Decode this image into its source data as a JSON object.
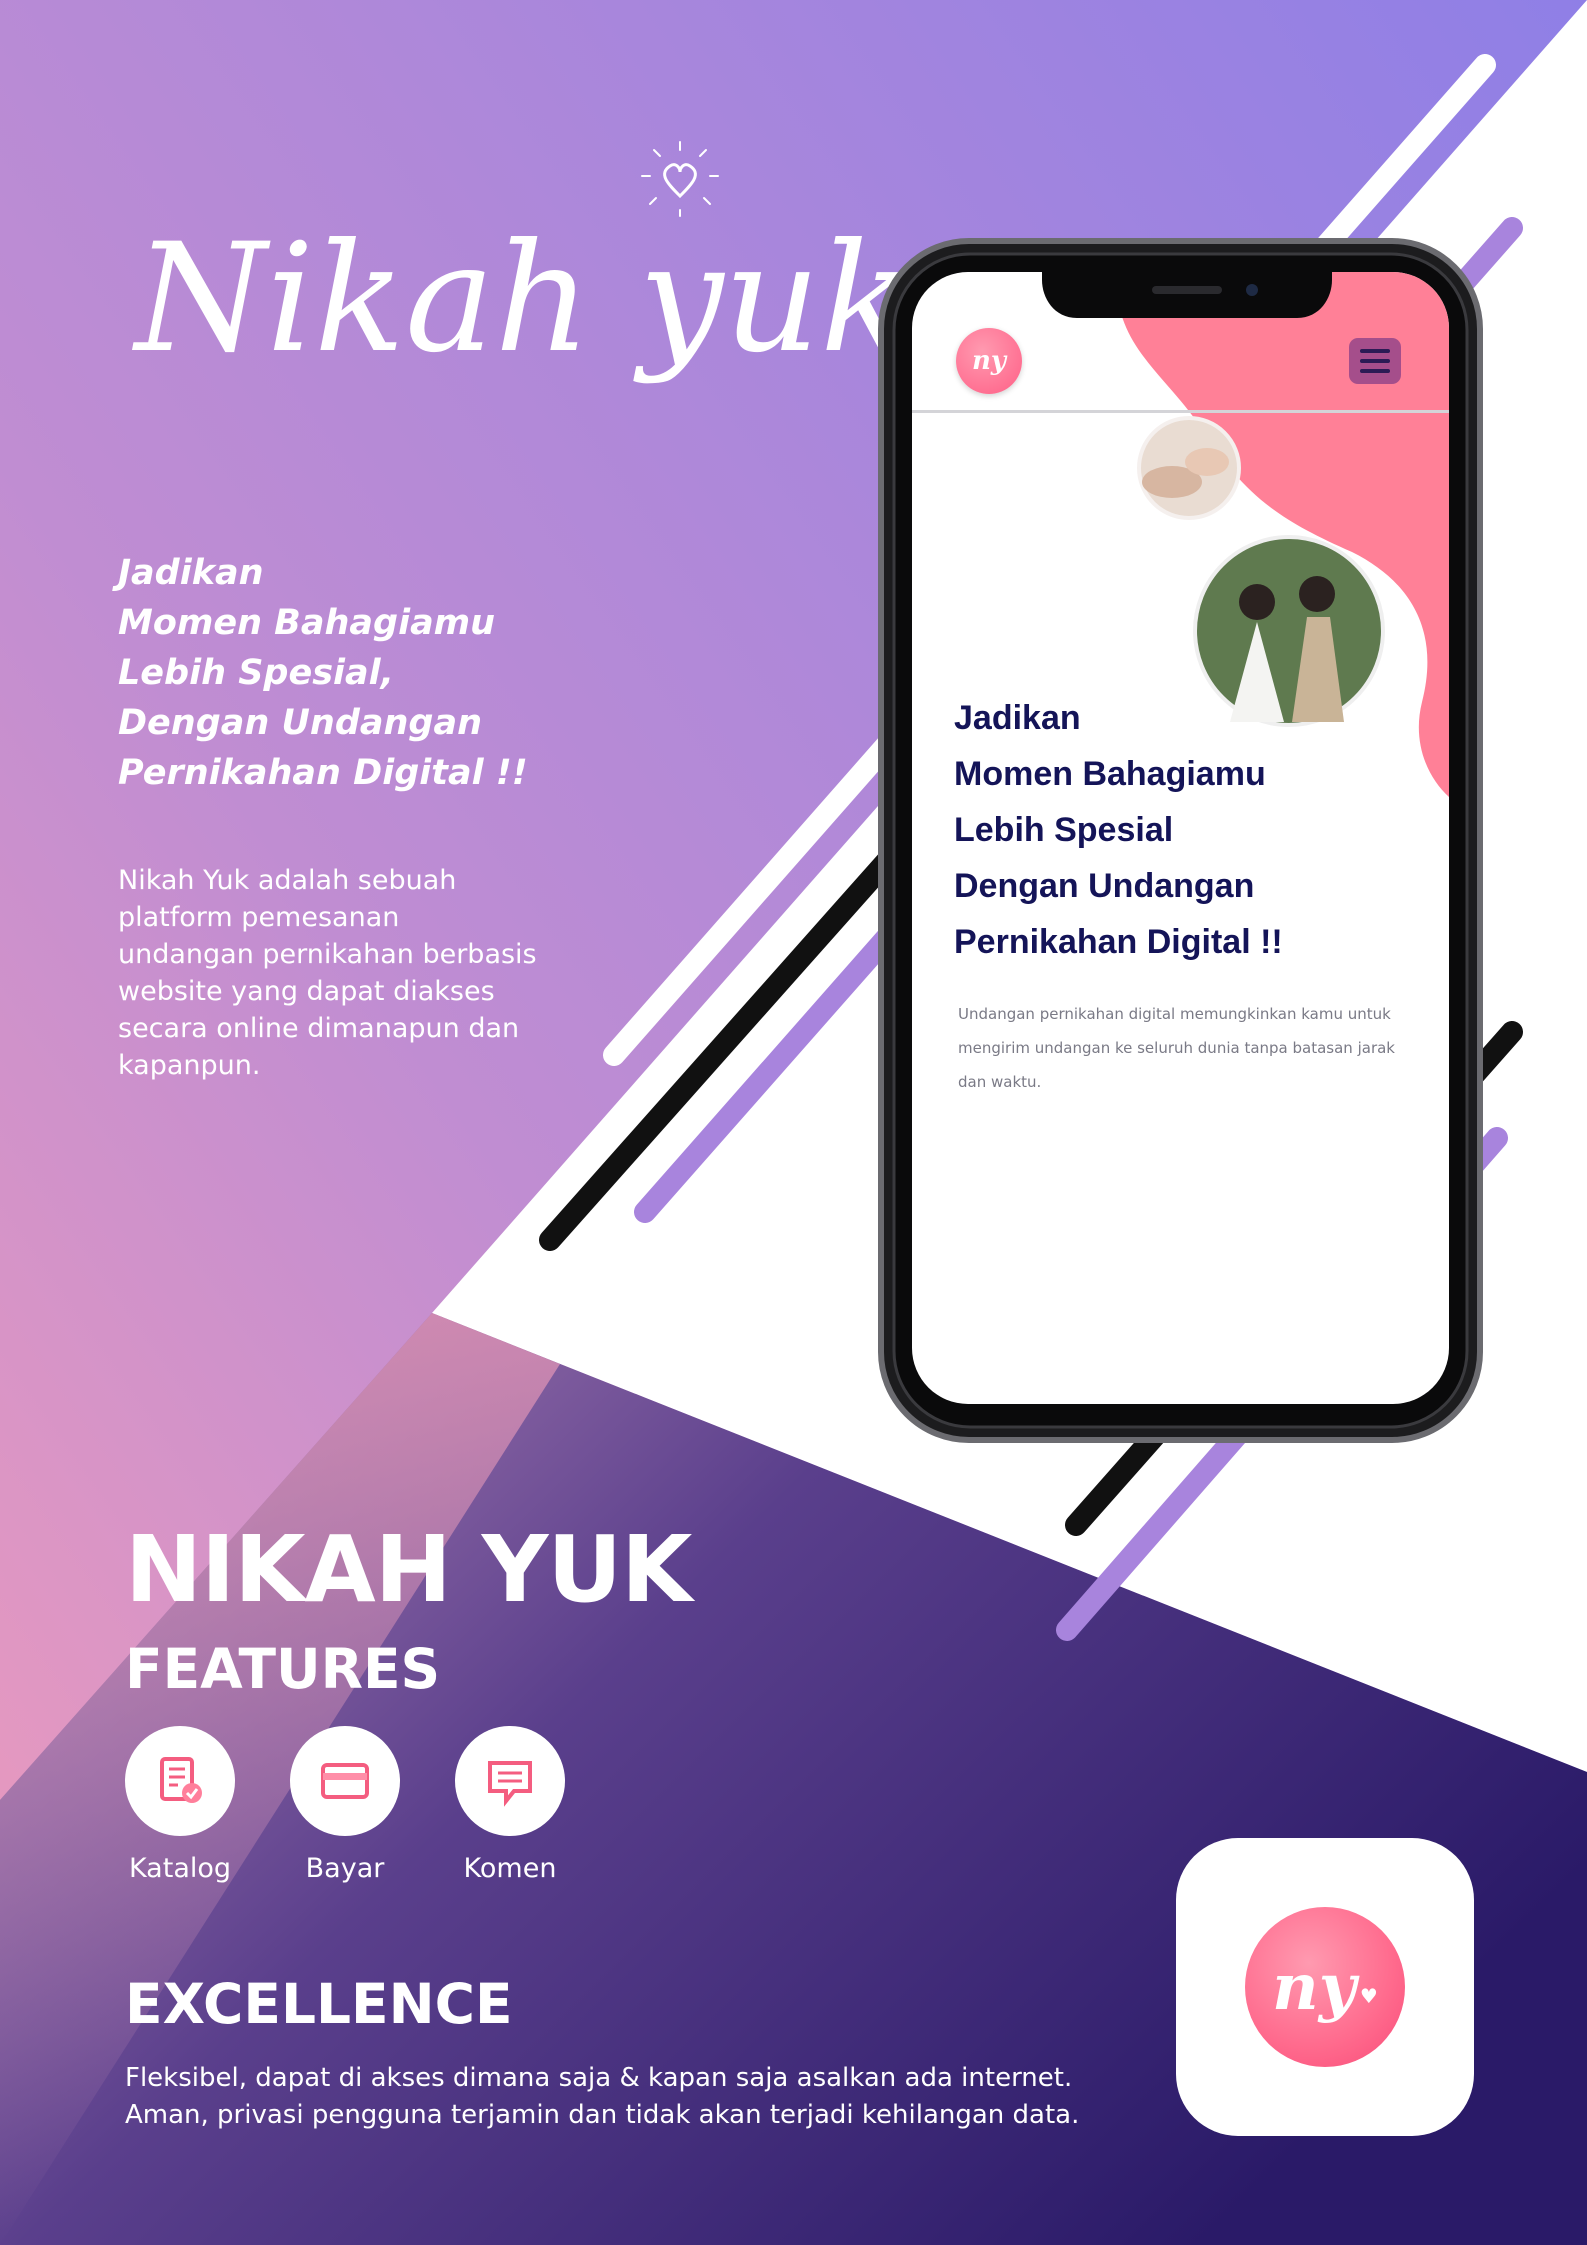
{
  "brand": {
    "script_title": "Nikah yuk",
    "logo_monogram": "ny"
  },
  "hero": {
    "tagline": [
      "Jadikan",
      "Momen Bahagiamu",
      "Lebih Spesial,",
      "Dengan Undangan",
      "Pernikahan Digital !!"
    ],
    "description": "Nikah Yuk adalah sebuah platform pemesanan undangan pernikahan berbasis website yang dapat diakses secara online dimanapun dan kapanpun."
  },
  "phone_screen": {
    "menu_icon": "hamburger-icon",
    "heading": [
      "Jadikan",
      "Momen Bahagiamu",
      "Lebih Spesial",
      "Dengan Undangan",
      "Pernikahan Digital !!"
    ],
    "body": "Undangan pernikahan digital memungkinkan kamu untuk  mengirim undangan ke seluruh dunia tanpa batasan jarak dan waktu."
  },
  "features_section": {
    "brand_heading": "NIKAH YUK",
    "heading": "FEATURES",
    "items": [
      {
        "label": "Katalog",
        "icon": "catalog-icon"
      },
      {
        "label": "Bayar",
        "icon": "card-icon"
      },
      {
        "label": "Komen",
        "icon": "comment-icon"
      }
    ]
  },
  "excellence": {
    "heading": "EXCELLENCE",
    "lines": [
      "Fleksibel, dapat di akses dimana saja & kapan saja asalkan ada internet.",
      "Aman, privasi pengguna terjamin dan tidak akan terjadi kehilangan data."
    ]
  },
  "colors": {
    "accent_pink": "#ff6f93",
    "screen_heading": "#141458",
    "lavender": "#a58be0",
    "dark_purple": "#2e1c66"
  }
}
